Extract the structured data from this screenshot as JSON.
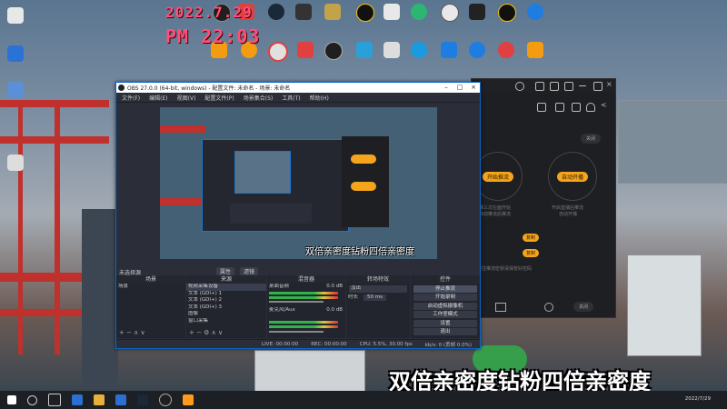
{
  "desktop": {
    "clock_date": "2022.7.29",
    "clock_time": "PM 22:03",
    "icon_colors": [
      "#2a72d6",
      "#e8e8e8",
      "#222",
      "#f39c12",
      "#1ea0e8",
      "#333",
      "#e04040",
      "#2bb673",
      "#1f1f1f",
      "#f2c200",
      "#1e7de0"
    ]
  },
  "back_app": {
    "ring_left_label": "开始推流",
    "ring_right_label": "自动开播",
    "ring_left_subtext": "推三次左面开始",
    "ring_left_subtext2": "启动推流后推流",
    "ring_right_subtext": "开启直播后推流",
    "ring_right_subtext2": "自动开播",
    "button_a": "复制",
    "button_b": "复制",
    "bottom_button": "关闭",
    "tiny_note": "记住推流密钥请保管好密码",
    "accent": "#f4a51c"
  },
  "obs": {
    "title": "OBS 27.0.0 (64-bit, windows) - 配置文件: 未命名 - 场景: 未命名",
    "menu": [
      "文件(F)",
      "编辑(E)",
      "视图(V)",
      "配置文件(P)",
      "场景集合(S)",
      "工具(T)",
      "帮助(H)"
    ],
    "preview_caption": "双倍亲密度钻粉四倍亲密度",
    "no_source_label": "未选择源",
    "filters_button": "属性",
    "filters_button2": "滤镜",
    "docks": {
      "scenes": {
        "title": "场景",
        "items": [
          "场景"
        ]
      },
      "sources": {
        "title": "来源",
        "items": [
          "视频采集设备",
          "文本 (GDI+) 1",
          "文本 (GDI+) 2",
          "文本 (GDI+) 3",
          "图像",
          "窗口采集"
        ]
      },
      "mixer": {
        "title": "混音器",
        "channels": [
          {
            "name": "桌面音频",
            "value": "0.0 dB"
          },
          {
            "name": "麦克风/Aux",
            "value": "0.0 dB"
          }
        ]
      },
      "transitions": {
        "title": "转场特效",
        "fade": "淡出",
        "duration_label": "时长",
        "duration_value": "50 ms"
      },
      "controls": {
        "title": "控件",
        "buttons": [
          "停止推流",
          "开始录制",
          "启动虚拟摄像机",
          "工作室模式",
          "设置",
          "退出"
        ]
      }
    },
    "status": {
      "live": "LIVE: 00:00:00",
      "rec": "REC: 00:00:00",
      "cpu": "CPU: 5.5%, 30.00 fps",
      "kb": "kb/s: 0 (丢帧 0.0%)"
    }
  },
  "overlay": {
    "big_caption": "双倍亲密度钻粉四倍亲密度"
  },
  "taskbar": {
    "date": "2022/7/29",
    "icon_colors": [
      "#ffffff",
      "#cccccc",
      "#2a6fd1",
      "#2a6fd1",
      "#e05a2a",
      "#2bb673",
      "#1a9be0",
      "#888888",
      "#ff9a1a"
    ]
  }
}
